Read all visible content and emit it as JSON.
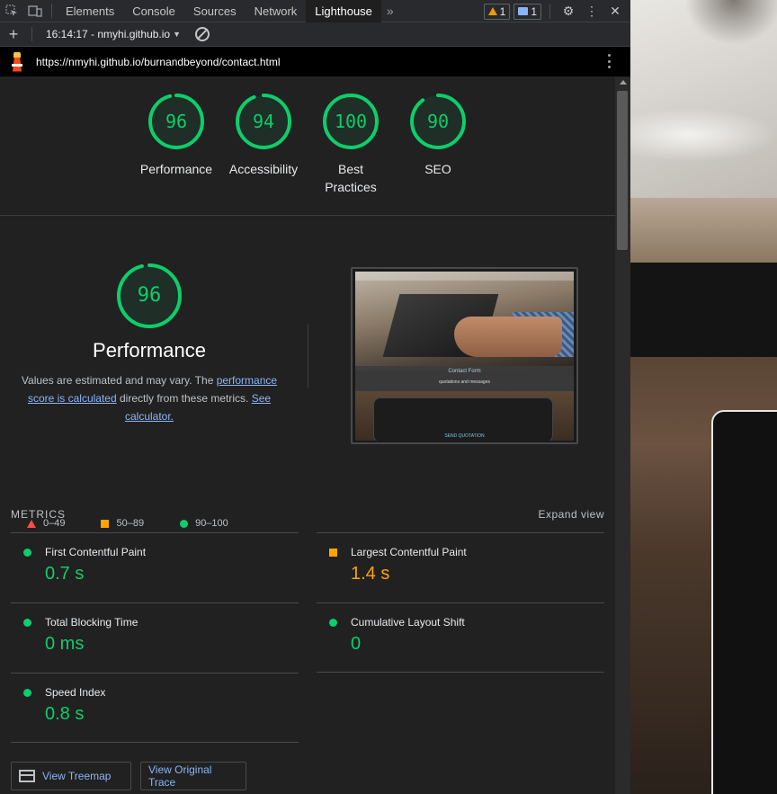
{
  "devtools": {
    "tabs": [
      "Elements",
      "Console",
      "Sources",
      "Network",
      "Lighthouse"
    ],
    "active_tab": "Lighthouse",
    "warnings_count": "1",
    "messages_count": "1"
  },
  "toolbar": {
    "report_label": "16:14:17 - nmyhi.github.io"
  },
  "url": "https://nmyhi.github.io/burnandbeyond/contact.html",
  "categories": [
    {
      "label": "Performance",
      "score": "96",
      "value": 96
    },
    {
      "label": "Accessibility",
      "score": "94",
      "value": 94
    },
    {
      "label": "Best Practices",
      "score": "100",
      "value": 100
    },
    {
      "label": "SEO",
      "score": "90",
      "value": 90
    }
  ],
  "performance": {
    "score": "96",
    "value": 96,
    "title": "Performance",
    "desc_prefix": "Values are estimated and may vary. The ",
    "desc_link1": "performance score is calculated",
    "desc_middle": " directly from these metrics. ",
    "desc_link2": "See calculator."
  },
  "legend": {
    "fail": "0–49",
    "average": "50–89",
    "pass": "90–100"
  },
  "screenshot": {
    "title": "Contact Form",
    "subtitle": "quotations and messages",
    "button": "SEND QUOTATION"
  },
  "metrics": {
    "title": "METRICS",
    "expand": "Expand view",
    "items": [
      {
        "name": "First Contentful Paint",
        "value": "0.7 s",
        "rating": "pass"
      },
      {
        "name": "Largest Contentful Paint",
        "value": "1.4 s",
        "rating": "average"
      },
      {
        "name": "Total Blocking Time",
        "value": "0 ms",
        "rating": "pass"
      },
      {
        "name": "Cumulative Layout Shift",
        "value": "0",
        "rating": "pass"
      },
      {
        "name": "Speed Index",
        "value": "0.8 s",
        "rating": "pass"
      }
    ]
  },
  "buttons": {
    "treemap": "View Treemap",
    "trace": "View Original Trace"
  },
  "colors": {
    "pass": "#0cce6b",
    "average": "#ffa400",
    "fail": "#ff4e42",
    "link": "#8ab4f8"
  }
}
